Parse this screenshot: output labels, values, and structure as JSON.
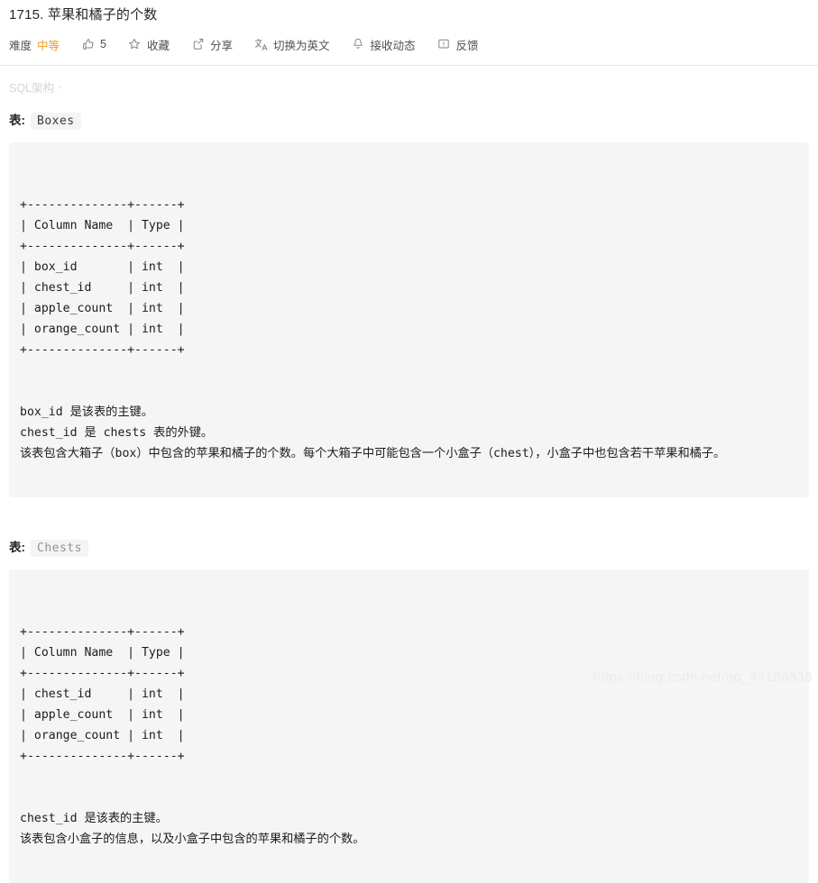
{
  "header": {
    "title": "1715. 苹果和橘子的个数",
    "meta": {
      "difficulty_label": "难度",
      "difficulty_value": "中等",
      "difficulty_color": "#ef9b22",
      "like_count": "5",
      "favorite_label": "收藏",
      "share_label": "分享",
      "translate_label": "切换为英文",
      "subscribe_label": "接收动态",
      "feedback_label": "反馈"
    }
  },
  "breadcrumb": {
    "label": "SQL架构",
    "chevron": "›"
  },
  "sections": [
    {
      "label_prefix": "表:",
      "table_name": "Boxes",
      "chip_muted": false,
      "code": "+--------------+------+\n| Column Name  | Type |\n+--------------+------+\n| box_id       | int  |\n| chest_id     | int  |\n| apple_count  | int  |\n| orange_count | int  |\n+--------------+------+",
      "description": "box_id 是该表的主键。\nchest_id 是 chests 表的外键。\n该表包含大箱子（box）中包含的苹果和橘子的个数。每个大箱子中可能包含一个小盒子（chest），小盒子中也包含若干苹果和橘子。"
    },
    {
      "label_prefix": "表:",
      "table_name": "Chests",
      "chip_muted": true,
      "code": "+--------------+------+\n| Column Name  | Type |\n+--------------+------+\n| chest_id     | int  |\n| apple_count  | int  |\n| orange_count | int  |\n+--------------+------+",
      "description": "chest_id 是该表的主键。\n该表包含小盒子的信息，以及小盒子中包含的苹果和橘子的个数。"
    }
  ],
  "watermark": "https://blog.csdn.net/qq_44186838"
}
